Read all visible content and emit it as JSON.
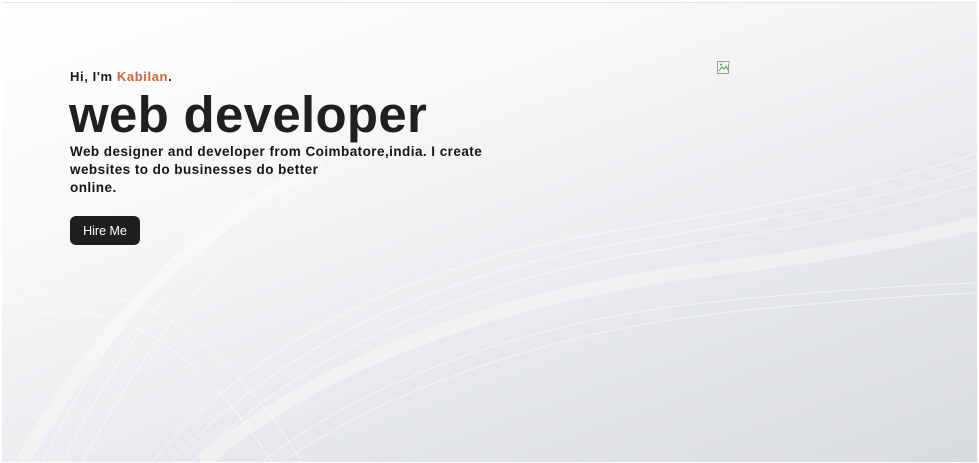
{
  "hero": {
    "greeting_prefix": "Hi, I'm ",
    "name": "Kabilan",
    "greeting_suffix": ".",
    "headline": "web developer",
    "description_line1": "Web designer and developer from Coimbatore,india. I create",
    "description_line2": "websites to do businesses do better",
    "description_line3": "online.",
    "hire_button_label": "Hire Me",
    "accent_color": "#d0653e",
    "button_color": "#1f1f1f"
  },
  "image": {
    "icon": "broken-image-icon"
  }
}
